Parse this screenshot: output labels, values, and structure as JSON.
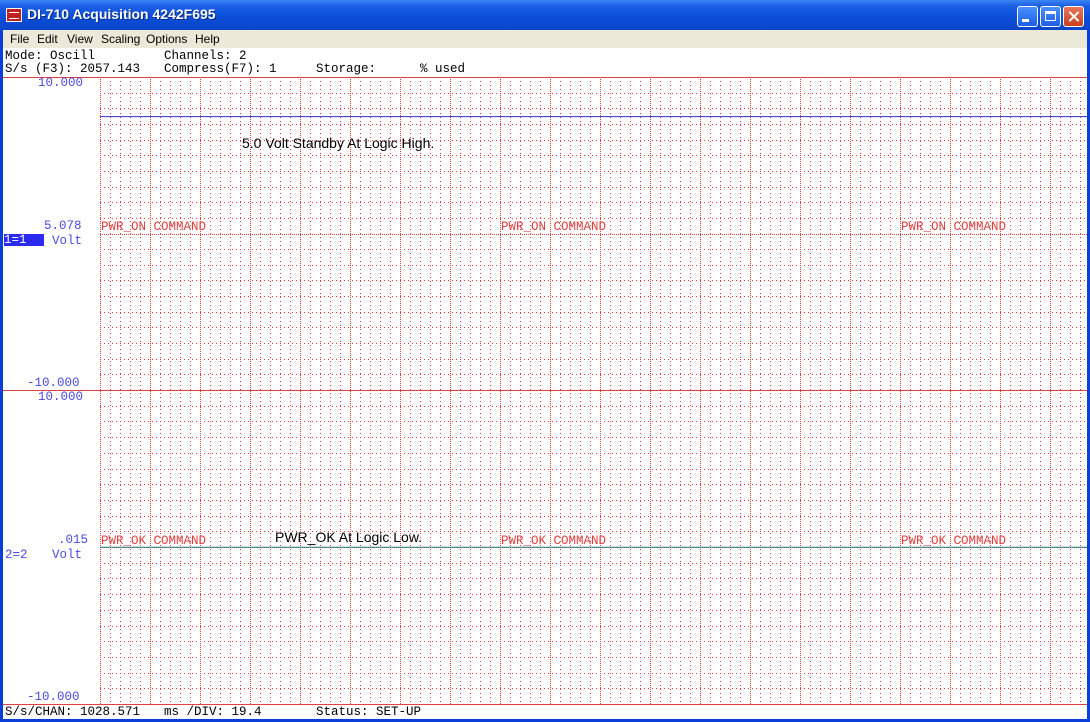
{
  "window": {
    "title": "DI-710 Acquisition 4242F695"
  },
  "menu": {
    "items": [
      "File",
      "Edit",
      "View",
      "Scaling",
      "Options",
      "Help"
    ]
  },
  "status_top": {
    "mode": "Mode: Oscill",
    "channels": "Channels: 2",
    "rate": "S/s (F3): 2057.143",
    "compress": "Compress(F7): 1",
    "storage": "Storage:",
    "used": "% used"
  },
  "channel1": {
    "top": "10.000",
    "mid": "5.078",
    "id": "1=1",
    "unit": "Volt",
    "bottom": "-10.000",
    "level": 7.5
  },
  "channel2": {
    "top": "10.000",
    "mid": ".015",
    "id": "2=2",
    "unit": "Volt",
    "bottom": "-10.000",
    "level": 0.015
  },
  "annotations": {
    "ch1": "5.0 Volt Standby At Logic High.",
    "ch2": "PWR_OK At Logic Low."
  },
  "markers": {
    "ch1": [
      "PWR_ON COMMAND",
      "PWR_ON COMMAND",
      "PWR_ON COMMAND"
    ],
    "ch2": [
      "PWR_OK COMMAND",
      "PWR_OK COMMAND",
      "PWR_OK COMMAND"
    ]
  },
  "status_bottom": {
    "chan_rate": "S/s/CHAN: 1028.571",
    "ms_div": "ms /DIV: 19.4",
    "status": "Status: SET-UP"
  },
  "colors": {
    "grid": "#e04040",
    "trace1": "#3030c0",
    "trace2": "#208080",
    "scale": "#4a4ae6"
  }
}
